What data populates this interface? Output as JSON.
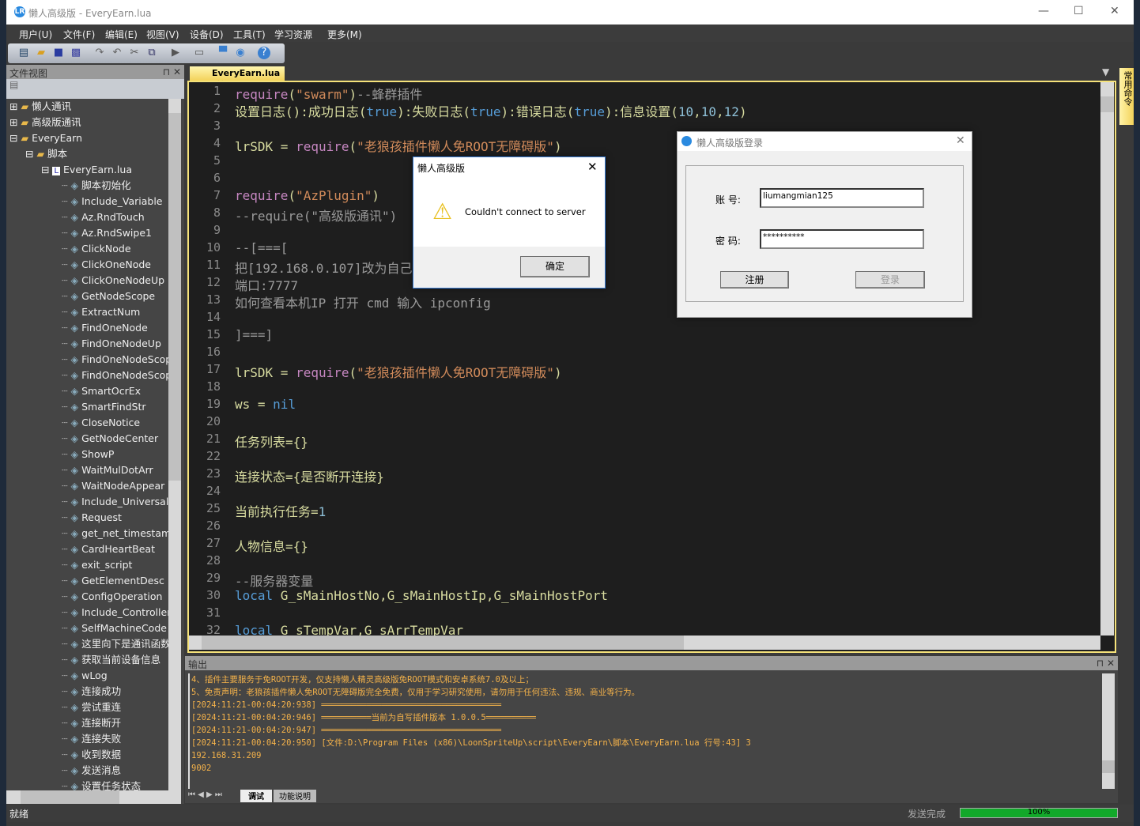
{
  "window": {
    "title": "懒人高级版 - EveryEarn.lua",
    "logo": "LR"
  },
  "menu": [
    "用户(U)",
    "文件(F)",
    "编辑(E)",
    "视图(V)",
    "设备(D)",
    "工具(T)",
    "学习资源",
    "更多(M)"
  ],
  "toolbar_icons": [
    "new-file-icon",
    "open-folder-icon",
    "save-icon",
    "save-all-icon",
    "redo-icon",
    "undo-icon",
    "cut-icon",
    "copy-icon",
    "run-icon",
    "window-icon",
    "android-icon",
    "camera-icon",
    "help-icon"
  ],
  "fileview": {
    "title": "文件视图",
    "folders": [
      "懒人通讯",
      "高级版通讯",
      "EveryEarn",
      "脚本",
      "EveryEarn.lua"
    ],
    "items": [
      "脚本初始化",
      "Include_Variable",
      "Az.RndTouch",
      "Az.RndSwipe1",
      "ClickNode",
      "ClickOneNode",
      "ClickOneNodeUp",
      "GetNodeScope",
      "ExtractNum",
      "FindOneNode",
      "FindOneNodeUp",
      "FindOneNodeScop",
      "FindOneNodeScop",
      "SmartOcrEx",
      "SmartFindStr",
      "CloseNotice",
      "GetNodeCenter",
      "ShowP",
      "WaitMulDotArr",
      "WaitNodeAppear",
      "Include_UniversalV",
      "Request",
      "get_net_timestamp",
      "CardHeartBeat",
      "exit_script",
      "GetElementDesc",
      "ConfigOperation",
      "Include_Controller",
      "SelfMachineCode",
      "这里向下是通讯函数",
      "获取当前设备信息",
      "wLog",
      "连接成功",
      "尝试重连",
      "连接断开",
      "连接失败",
      "收到数据",
      "发送消息",
      "设置任务状态"
    ]
  },
  "editor": {
    "tab": "EveryEarn.lua",
    "lines": [
      "<span class='kw'>require</span>(<span class='str'>\"swarm\"</span>)<span class='cm'>--蜂群插件</span>",
      "设置日志():成功日志(<span class='bl'>true</span>):失败日志(<span class='bl'>true</span>):错误日志(<span class='bl'>true</span>):信息设置(<span class='num'>10</span>,<span class='num'>10</span>,<span class='num'>12</span>)",
      "",
      "lrSDK = <span class='kw'>require</span>(<span class='str'>\"老狼孩插件懒人免ROOT无障碍版\"</span>)",
      "",
      "",
      "<span class='kw'>require</span>(<span class='str'>\"AzPlugin\"</span>)",
      "<span class='cm'>--require(\"高级版通讯\")</span>",
      "",
      "<span class='cm'>--[===[</span>",
      "<span class='cm'>把[192.168.0.107]改为自己</span>",
      "<span class='cm'>端口:7777</span>",
      "<span class='cm'>如何查看本机IP 打开 cmd 输入 ipconfig</span>",
      "",
      "<span class='cm'>]===]</span>",
      "",
      "lrSDK = <span class='kw'>require</span>(<span class='str'>\"老狼孩插件懒人免ROOT无障碍版\"</span>)",
      "",
      "ws = <span class='bl'>nil</span>",
      "",
      "任务列表={}",
      "",
      "连接状态={是否断开连接}",
      "",
      "当前执行任务=<span class='num'>1</span>",
      "",
      "人物信息={}",
      "",
      "<span class='cm'>--服务器变量</span>",
      "<span class='bl'>local</span> G_sMainHostNo,G_sMainHostIp,G_sMainHostPort",
      "",
      "<span class='bl'>local</span> G_sTempVar,G_sArrTempVar"
    ]
  },
  "side_tab": "常用命令",
  "output": {
    "title": "输出",
    "lines": [
      "4、插件主要服务于免ROOT开发，仅支持懒人精灵高级版免ROOT模式和安卓系统7.0及以上；",
      "5、免责声明：老狼孩插件懒人免ROOT无障碍版完全免费，仅用于学习研究使用，请勿用于任何违法、违规、商业等行为。",
      "[2024:11:21-00:04:20:938] ════════════════════════════════════",
      "[2024:11:21-00:04:20:946] ══════════当前为自写插件版本 1.0.0.5══════════",
      "[2024:11:21-00:04:20:947] ════════════════════════════════════",
      "[2024:11:21-00:04:20:950] [文件:D:\\Program Files (x86)\\LoonSpriteUp\\script\\EveryEarn\\脚本\\EveryEarn.lua 行号:43] 3",
      "192.168.31.209",
      "9002"
    ],
    "tabs": [
      "调试",
      "功能说明"
    ]
  },
  "status": {
    "left": "就绪",
    "send": "发送完成",
    "progress": 100,
    "progress_label": "100%",
    "progress_color": "#12a82a"
  },
  "alert": {
    "title": "懒人高级版",
    "message": "Couldn't connect to server",
    "ok": "确定",
    "icon": "warning-icon"
  },
  "login": {
    "title": "懒人高级版登录",
    "account_label": "账 号:",
    "account_value": "liumangmian125",
    "password_label": "密 码:",
    "password_value": "**********",
    "register": "注册",
    "login": "登录"
  }
}
